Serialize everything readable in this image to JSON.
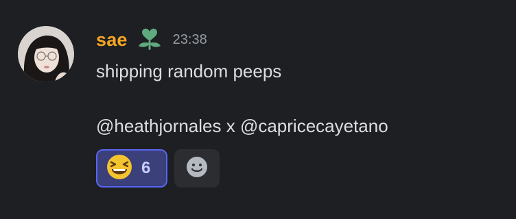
{
  "message": {
    "author": "sae",
    "timestamp": "23:38",
    "lines": [
      "shipping random peeps",
      "",
      "@heathjornales x @capricecayetano"
    ]
  },
  "reactions": [
    {
      "emoji_icon": "laughing-face-icon",
      "count": "6",
      "active": true
    },
    {
      "emoji_icon": "add-reaction-icon",
      "active": false
    }
  ],
  "colors": {
    "background": "#1e1f22",
    "username": "#f5a623",
    "timestamp": "#949ba4",
    "text": "#dbdee1",
    "reaction_active_bg": "#3b3f7a",
    "reaction_active_border": "#5865f2",
    "reaction_count": "#c9cdfb",
    "role_icon": "#5faa7e"
  }
}
